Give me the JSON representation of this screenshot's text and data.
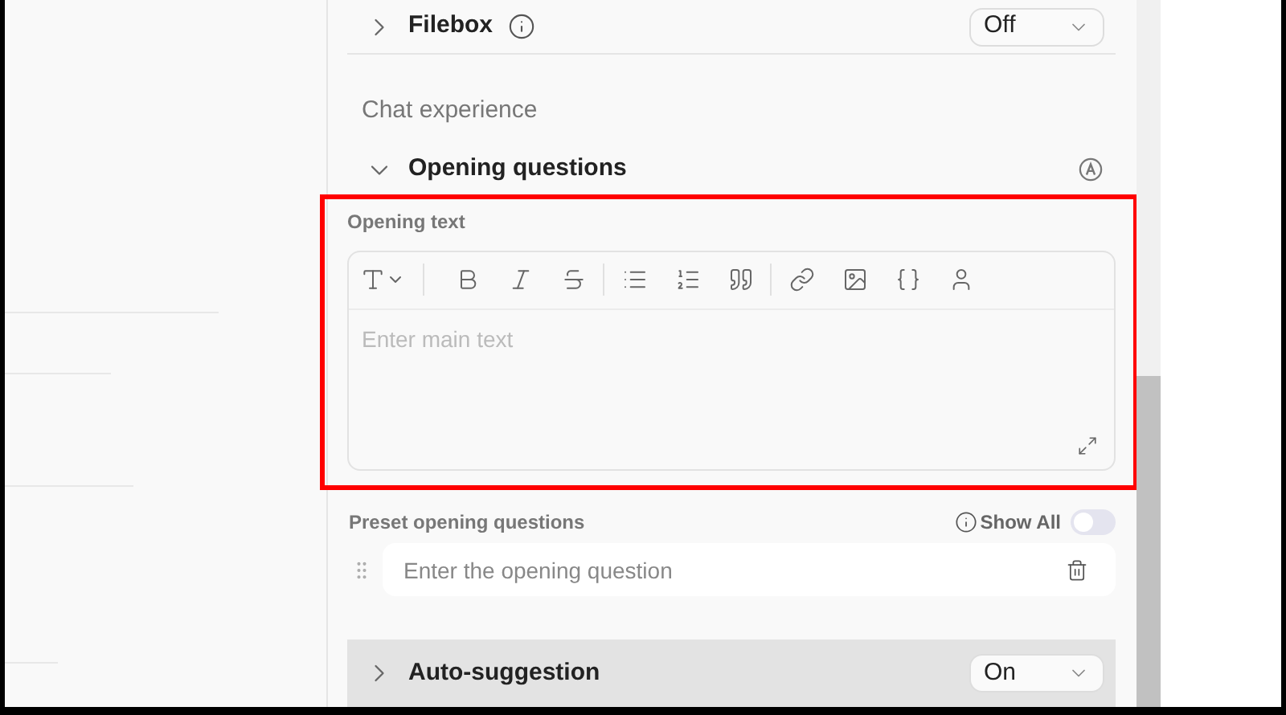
{
  "filebox": {
    "label": "Filebox",
    "expanded": false,
    "dropdown": "Off"
  },
  "section_title": "Chat experience",
  "opening_questions": {
    "label": "Opening questions",
    "expanded": true,
    "opening_text": {
      "label": "Opening text",
      "placeholder": "Enter main text"
    },
    "preset": {
      "label": "Preset opening questions",
      "show_all_label": "Show All",
      "show_all_on": false,
      "questions": [
        {
          "placeholder": "Enter the opening question"
        }
      ]
    }
  },
  "auto_suggestion": {
    "label": "Auto-suggestion",
    "expanded": false,
    "dropdown": "On"
  }
}
